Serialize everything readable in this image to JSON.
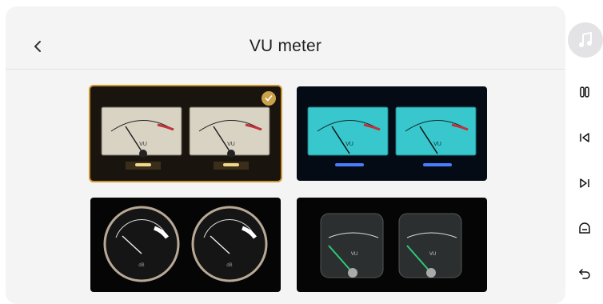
{
  "header": {
    "title": "VU meter"
  },
  "icons": {
    "back": "chevron-left-icon",
    "album": "music-note-icon",
    "pause": "pause-icon",
    "prev": "skip-previous-icon",
    "next": "skip-next-icon",
    "home": "home-icon",
    "return": "return-icon"
  },
  "styles": [
    {
      "name": "classic-cream",
      "selected": true,
      "meter_label": "VU"
    },
    {
      "name": "cyan",
      "selected": false,
      "meter_label": "VU"
    },
    {
      "name": "round-black",
      "selected": false,
      "meter_label": "dB"
    },
    {
      "name": "green-needle",
      "selected": false,
      "meter_label": "VU"
    }
  ],
  "colors": {
    "accent": "#c9a24a",
    "cyan": "#38c7cc",
    "needle_green": "#2ec97a",
    "redline": "#c0323a"
  }
}
